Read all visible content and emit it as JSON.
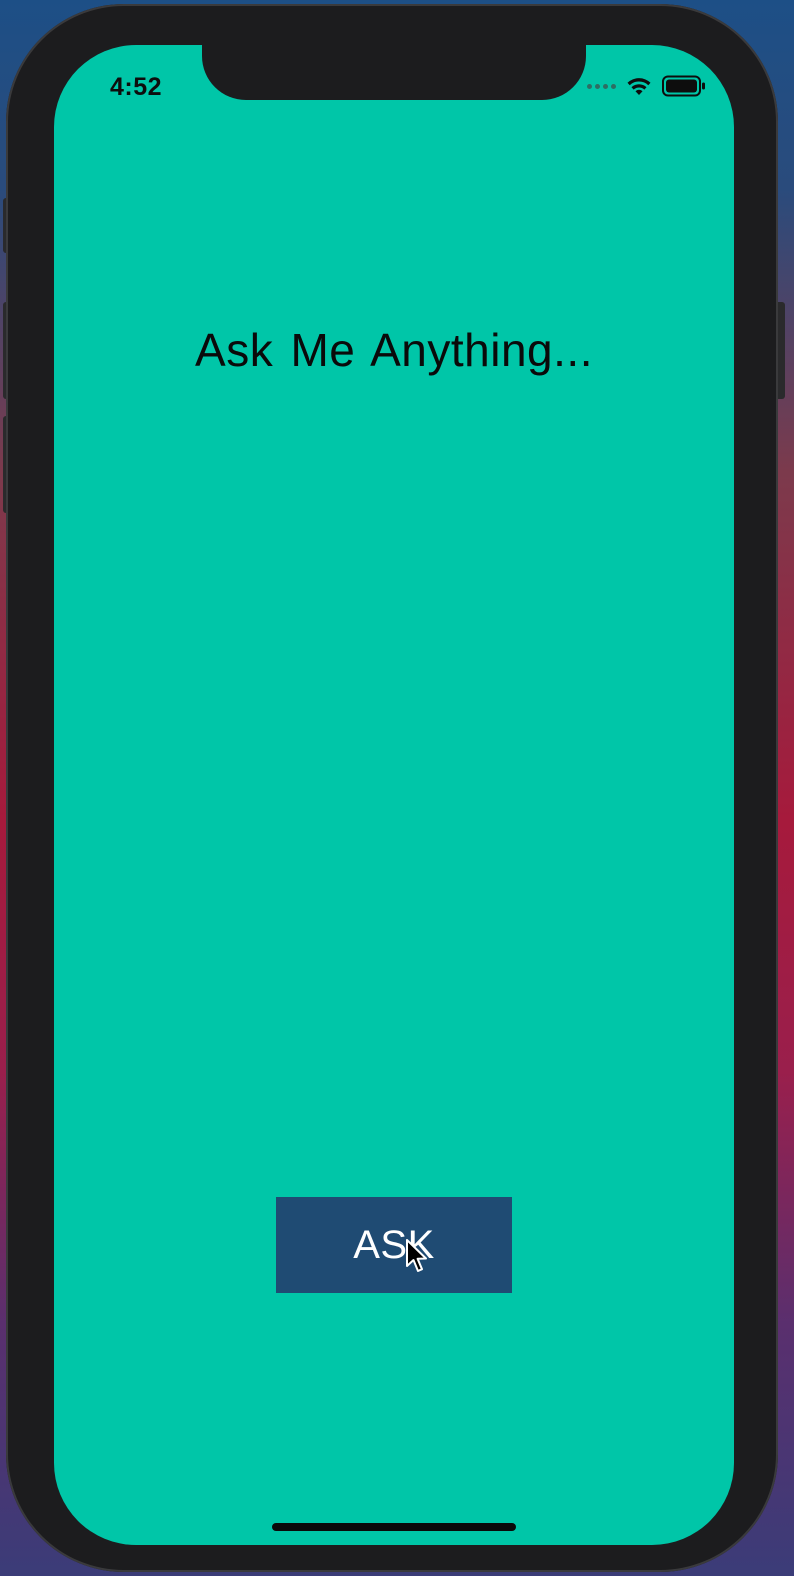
{
  "status_bar": {
    "time": "4:52",
    "wifi_icon": "wifi-icon",
    "battery_icon": "battery-icon",
    "signal_icon": "signal-dots-icon"
  },
  "main": {
    "title": "Ask Me Anything...",
    "ask_button_label": "ASK"
  },
  "colors": {
    "screen_background": "#00c6a8",
    "button_background": "#1f4b73",
    "button_text": "#ffffff",
    "title_text": "#0a0a0a"
  }
}
